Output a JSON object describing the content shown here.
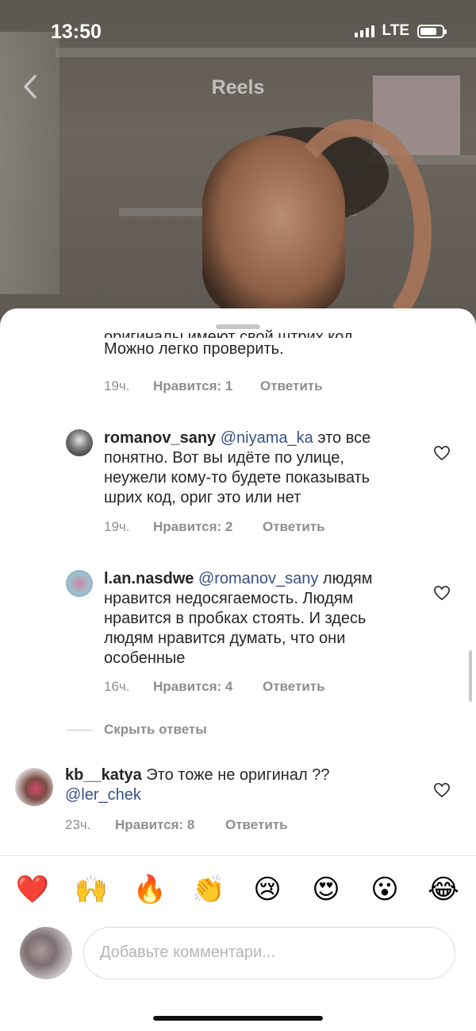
{
  "status_bar": {
    "time": "13:50",
    "network": "LTE"
  },
  "header": {
    "title": "Reels"
  },
  "comments": [
    {
      "text_line1": "оригиналы имеют свой штрих код.",
      "text_line2": "Можно легко проверить.",
      "time": "19ч.",
      "likes": "Нравится: 1",
      "reply": "Ответить"
    },
    {
      "username": "romanov_sany",
      "mention": "@niyama_ka",
      "text": [
        " это все",
        "понятно. Вот вы идёте по улице,",
        "неужели кому-то будете показывать",
        "шрих код, ориг это или нет"
      ],
      "time": "19ч.",
      "likes": "Нравится: 2",
      "reply": "Ответить"
    },
    {
      "username": "l.an.nasdwe",
      "mention": "@romanov_sany",
      "text": [
        " людям",
        "нравится недосягаемость. Людям",
        "нравится в пробках стоять. И здесь",
        "людям нравится думать, что они",
        "особенные"
      ],
      "time": "16ч.",
      "likes": "Нравится: 4",
      "reply": "Ответить"
    },
    {
      "username": "kb__katya",
      "text": " Это тоже не оригинал ??",
      "mention": "@ler_chek",
      "time": "23ч.",
      "likes": "Нравится: 8",
      "reply": "Ответить"
    }
  ],
  "hide_replies": "Скрыть ответы",
  "reactions": [
    "❤️",
    "🙌",
    "🔥",
    "👏",
    "😢",
    "😍",
    "😮",
    "😂"
  ],
  "composer": {
    "placeholder": "Добавьте комментари..."
  },
  "colors": {
    "mention": "#385185",
    "meta": "#8e8e8e",
    "heart": "#262626"
  }
}
